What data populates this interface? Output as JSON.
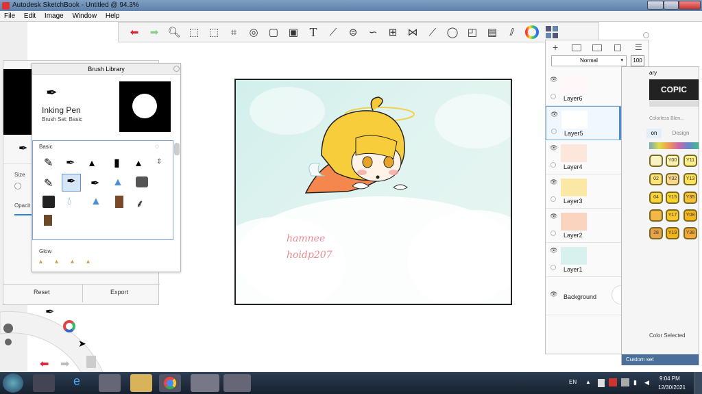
{
  "window": {
    "title": "Autodesk SketchBook - Untitled @ 94.3%"
  },
  "menu": [
    "File",
    "Edit",
    "Image",
    "Window",
    "Help"
  ],
  "toolbar": {
    "icons": [
      "undo-icon",
      "redo-icon",
      "zoom-icon",
      "select-rect-icon",
      "lasso-select-icon",
      "crop-icon",
      "transform-icon",
      "distort-icon",
      "paint-bucket-icon",
      "text-icon",
      "ruler-icon",
      "ellipse-guide-icon",
      "curve-guide-icon",
      "perspective-icon",
      "symmetry-icon",
      "stroke-icon",
      "ellipse-icon",
      "shapes-icon",
      "copic-library-icon",
      "brush-palette-icon",
      "color-wheel-icon",
      "brush-set-icon"
    ]
  },
  "brush_library": {
    "title": "Brush Library",
    "brush_name": "Inking Pen",
    "brush_set": "Brush Set: Basic",
    "section_basic": "Basic",
    "section_glow": "Glow"
  },
  "left_panel": {
    "size_label": "Size",
    "opacity_label": "Opacit",
    "reset": "Reset",
    "export": "Export"
  },
  "layers": {
    "blend_mode": "Normal",
    "opacity": "100",
    "items": [
      "Layer6",
      "Layer5",
      "Layer4",
      "Layer3",
      "Layer2",
      "Layer1"
    ],
    "background": "Background"
  },
  "copic": {
    "title": "ary",
    "tab1": "on",
    "tab2": "Design",
    "sub": "Colorless Blen...",
    "swatches": [
      "Y00",
      "Y11",
      "02",
      "Y32",
      "Y13",
      "04",
      "Y15",
      "Y35",
      "Y17",
      "Y08",
      "28",
      "Y19",
      "Y38"
    ],
    "color_selected": "Color Selected",
    "custom_set": "Custom set"
  },
  "canvas": {
    "signature_1": "hamnee",
    "signature_2": "hoidp207"
  },
  "taskbar": {
    "lang": "EN",
    "time": "9:04 PM",
    "date": "12/30/2021"
  }
}
